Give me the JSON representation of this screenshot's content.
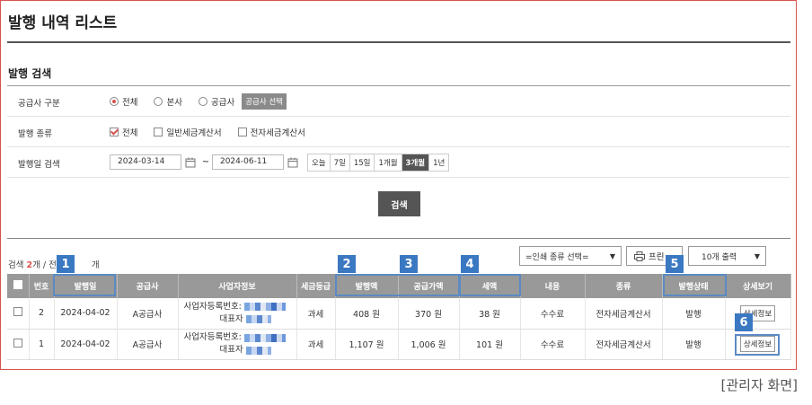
{
  "page": {
    "title": "발행 내역 리스트",
    "caption": "[관리자 화면]"
  },
  "filter": {
    "section_title": "발행 검색",
    "supplier": {
      "label": "공급사 구분",
      "options": [
        "전체",
        "본사",
        "공급사"
      ],
      "selected": "전체",
      "select_button": "공급사 선택"
    },
    "type": {
      "label": "발행 종류",
      "options": [
        "전체",
        "일반세금계산서",
        "전자세금계산서"
      ],
      "checked": "전체"
    },
    "date": {
      "label": "발행일 검색",
      "from": "2024-03-14",
      "to": "2024-06-11",
      "separator": "~",
      "ranges": [
        "오늘",
        "7일",
        "15일",
        "1개월",
        "3개월",
        "1년"
      ],
      "active_range": "3개월"
    },
    "search_button": "검색"
  },
  "list": {
    "count_prefix": "검색",
    "count_value": "2",
    "count_unit": "개",
    "count_rest": "/ 전",
    "count_rest2": "개",
    "print_select": "=인쇄 종류 선택=",
    "print_button": "프린",
    "per_page": "10개 출력",
    "columns": [
      "번호",
      "발행일",
      "공급사",
      "사업자정보",
      "세금등급",
      "발행액",
      "공급가액",
      "세액",
      "내용",
      "종류",
      "발행상태",
      "상세보기"
    ],
    "rows": [
      {
        "no": "2",
        "date": "2024-04-02",
        "supplier": "A공급사",
        "biz_label": "사업자등록번호:",
        "rep_label": "대표자",
        "tax": "과세",
        "amount": "408 원",
        "supply": "370 원",
        "vat": "38 원",
        "content": "수수료",
        "kind": "전자세금계산서",
        "status": "발행",
        "detail": "상세정보"
      },
      {
        "no": "1",
        "date": "2024-04-02",
        "supplier": "A공급사",
        "biz_label": "사업자등록번호:",
        "rep_label": "대표자",
        "tax": "과세",
        "amount": "1,107 원",
        "supply": "1,006 원",
        "vat": "101 원",
        "content": "수수료",
        "kind": "전자세금계산서",
        "status": "발행",
        "detail": "상세정보"
      }
    ]
  },
  "badges": [
    "1",
    "2",
    "3",
    "4",
    "5",
    "6"
  ],
  "colors": {
    "accent_red": "#d9534f",
    "badge_blue": "#3a78c2",
    "header_gray": "#999999"
  }
}
